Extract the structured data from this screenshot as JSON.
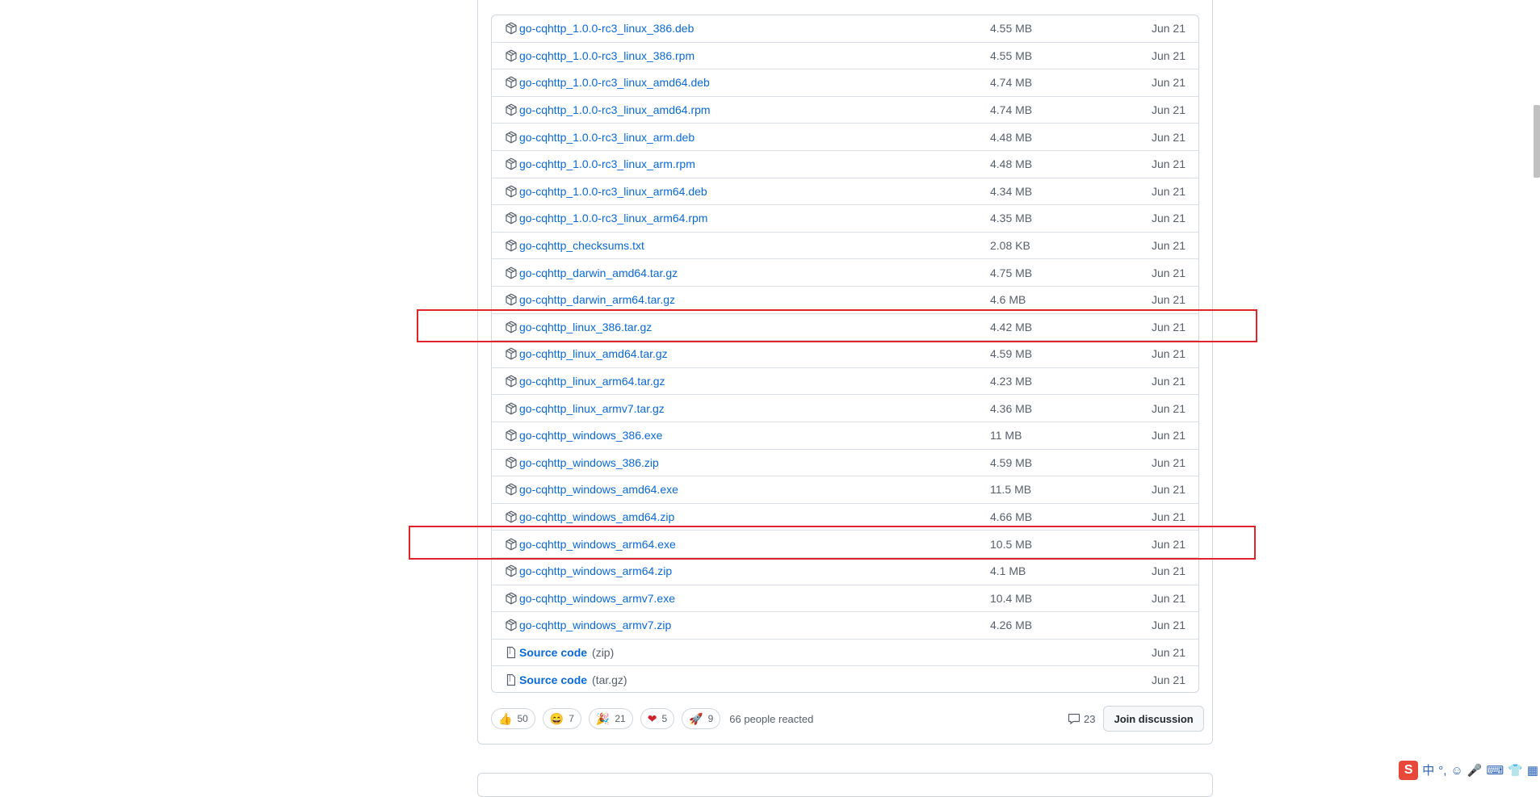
{
  "assets": [
    {
      "name": "go-cqhttp_1.0.0-rc3_linux_386.deb",
      "size": "4.55 MB",
      "date": "Jun 21",
      "icon": "package-icon"
    },
    {
      "name": "go-cqhttp_1.0.0-rc3_linux_386.rpm",
      "size": "4.55 MB",
      "date": "Jun 21",
      "icon": "package-icon"
    },
    {
      "name": "go-cqhttp_1.0.0-rc3_linux_amd64.deb",
      "size": "4.74 MB",
      "date": "Jun 21",
      "icon": "package-icon"
    },
    {
      "name": "go-cqhttp_1.0.0-rc3_linux_amd64.rpm",
      "size": "4.74 MB",
      "date": "Jun 21",
      "icon": "package-icon"
    },
    {
      "name": "go-cqhttp_1.0.0-rc3_linux_arm.deb",
      "size": "4.48 MB",
      "date": "Jun 21",
      "icon": "package-icon"
    },
    {
      "name": "go-cqhttp_1.0.0-rc3_linux_arm.rpm",
      "size": "4.48 MB",
      "date": "Jun 21",
      "icon": "package-icon"
    },
    {
      "name": "go-cqhttp_1.0.0-rc3_linux_arm64.deb",
      "size": "4.34 MB",
      "date": "Jun 21",
      "icon": "package-icon"
    },
    {
      "name": "go-cqhttp_1.0.0-rc3_linux_arm64.rpm",
      "size": "4.35 MB",
      "date": "Jun 21",
      "icon": "package-icon"
    },
    {
      "name": "go-cqhttp_checksums.txt",
      "size": "2.08 KB",
      "date": "Jun 21",
      "icon": "package-icon"
    },
    {
      "name": "go-cqhttp_darwin_amd64.tar.gz",
      "size": "4.75 MB",
      "date": "Jun 21",
      "icon": "package-icon"
    },
    {
      "name": "go-cqhttp_darwin_arm64.tar.gz",
      "size": "4.6 MB",
      "date": "Jun 21",
      "icon": "package-icon"
    },
    {
      "name": "go-cqhttp_linux_386.tar.gz",
      "size": "4.42 MB",
      "date": "Jun 21",
      "icon": "package-icon",
      "highlighted": true
    },
    {
      "name": "go-cqhttp_linux_amd64.tar.gz",
      "size": "4.59 MB",
      "date": "Jun 21",
      "icon": "package-icon"
    },
    {
      "name": "go-cqhttp_linux_arm64.tar.gz",
      "size": "4.23 MB",
      "date": "Jun 21",
      "icon": "package-icon"
    },
    {
      "name": "go-cqhttp_linux_armv7.tar.gz",
      "size": "4.36 MB",
      "date": "Jun 21",
      "icon": "package-icon"
    },
    {
      "name": "go-cqhttp_windows_386.exe",
      "size": "11 MB",
      "date": "Jun 21",
      "icon": "package-icon"
    },
    {
      "name": "go-cqhttp_windows_386.zip",
      "size": "4.59 MB",
      "date": "Jun 21",
      "icon": "package-icon"
    },
    {
      "name": "go-cqhttp_windows_amd64.exe",
      "size": "11.5 MB",
      "date": "Jun 21",
      "icon": "package-icon"
    },
    {
      "name": "go-cqhttp_windows_amd64.zip",
      "size": "4.66 MB",
      "date": "Jun 21",
      "icon": "package-icon"
    },
    {
      "name": "go-cqhttp_windows_arm64.exe",
      "size": "10.5 MB",
      "date": "Jun 21",
      "icon": "package-icon",
      "highlighted": true
    },
    {
      "name": "go-cqhttp_windows_arm64.zip",
      "size": "4.1 MB",
      "date": "Jun 21",
      "icon": "package-icon"
    },
    {
      "name": "go-cqhttp_windows_armv7.exe",
      "size": "10.4 MB",
      "date": "Jun 21",
      "icon": "package-icon"
    },
    {
      "name": "go-cqhttp_windows_armv7.zip",
      "size": "4.26 MB",
      "date": "Jun 21",
      "icon": "package-icon"
    },
    {
      "name": "Source code",
      "suffix": "(zip)",
      "size": "",
      "date": "Jun 21",
      "icon": "file-zip-icon"
    },
    {
      "name": "Source code",
      "suffix": "(tar.gz)",
      "size": "",
      "date": "Jun 21",
      "icon": "file-zip-icon"
    }
  ],
  "reactions": [
    {
      "emoji": "👍",
      "icon": "thumbs-up-icon",
      "count": "50"
    },
    {
      "emoji": "😄",
      "icon": "laugh-icon",
      "count": "7"
    },
    {
      "emoji": "🎉",
      "icon": "hooray-icon",
      "count": "21"
    },
    {
      "emoji": "❤",
      "icon": "heart-icon",
      "count": "5"
    },
    {
      "emoji": "🚀",
      "icon": "rocket-icon",
      "count": "9"
    }
  ],
  "reacted_text": "66 people reacted",
  "comment_count": "23",
  "join_label": "Join discussion",
  "ime": {
    "logo": "S",
    "items": [
      "中",
      "°,",
      "☺",
      "🎤",
      "⌨",
      "👕",
      "▦"
    ]
  },
  "colors": {
    "link": "#0969da",
    "highlight": "#e0242a",
    "ime_logo": "#e8483a"
  }
}
